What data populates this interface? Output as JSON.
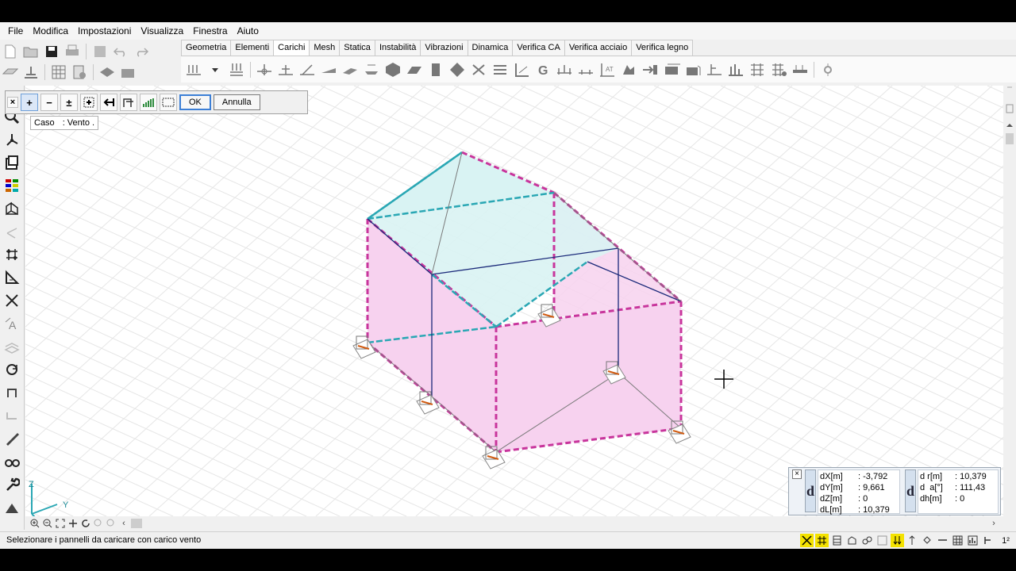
{
  "menu": [
    "File",
    "Modifica",
    "Impostazioni",
    "Visualizza",
    "Finestra",
    "Aiuto"
  ],
  "tabs": [
    {
      "label": "Geometria",
      "active": false
    },
    {
      "label": "Elementi",
      "active": false
    },
    {
      "label": "Carichi",
      "active": true
    },
    {
      "label": "Mesh",
      "active": false
    },
    {
      "label": "Statica",
      "active": false
    },
    {
      "label": "Instabilità",
      "active": false
    },
    {
      "label": "Vibrazioni",
      "active": false
    },
    {
      "label": "Dinamica",
      "active": false
    },
    {
      "label": "Verifica CA",
      "active": false
    },
    {
      "label": "Verifica acciaio",
      "active": false
    },
    {
      "label": "Verifica legno",
      "active": false
    }
  ],
  "load_panel": {
    "close_glyph": "×",
    "add_glyph": "+",
    "remove_glyph": "−",
    "toggle_glyph": "±",
    "ok_label": "OK",
    "cancel_label": "Annulla"
  },
  "case_info": {
    "label": "Caso",
    "value": ": Vento ."
  },
  "axes": {
    "z": "Z",
    "y": "Y",
    "x": "X"
  },
  "measure": {
    "close_glyph": "×",
    "letter": "d",
    "left": [
      {
        "label": "dX[m]",
        "value": ": -3,792"
      },
      {
        "label": "dY[m]",
        "value": ": 9,661"
      },
      {
        "label": "dZ[m]",
        "value": ": 0"
      },
      {
        "label": "dL[m]",
        "value": ": 10,379"
      }
    ],
    "right": [
      {
        "label": "d r[m]",
        "value": ": 10,379"
      },
      {
        "label": "d  a[°]",
        "value": ": 111,43"
      },
      {
        "label": "dh[m]",
        "value": ": 0"
      }
    ]
  },
  "status": {
    "message": "Selezionare i pannelli da caricare con carico vento",
    "scale_label": "1²"
  },
  "colors": {
    "accent": "#3c7fd6",
    "panel_fill": "#f7d2ef",
    "roof_fill": "#d9f3f3",
    "member_pink": "#c8359c",
    "member_cyan": "#2aa7b4",
    "frame_blue": "#1b2a7a"
  }
}
